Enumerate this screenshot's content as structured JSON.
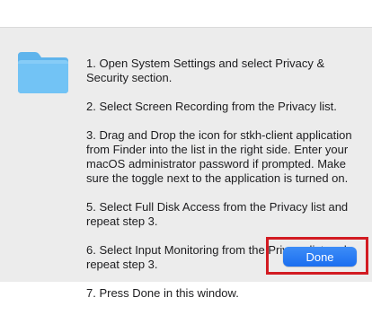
{
  "dialog": {
    "icon": "folder-icon",
    "instructions": [
      "1. Open System Settings and select Privacy & Security section.",
      "2. Select Screen Recording from the Privacy list.",
      "3. Drag and Drop the icon for stkh-client application from Finder into the list in the right side. Enter your macOS administrator password if prompted. Make sure the toggle next to the application is turned on.",
      "5. Select Full Disk Access from the Privacy list and repeat step 3.",
      "6. Select Input Monitoring from the Privacy list and repeat step 3.",
      "7. Press Done in this window."
    ],
    "done_label": "Done"
  },
  "colors": {
    "accent": "#1b6ef0",
    "highlight": "#d21b22",
    "panel_bg": "#ececec"
  }
}
